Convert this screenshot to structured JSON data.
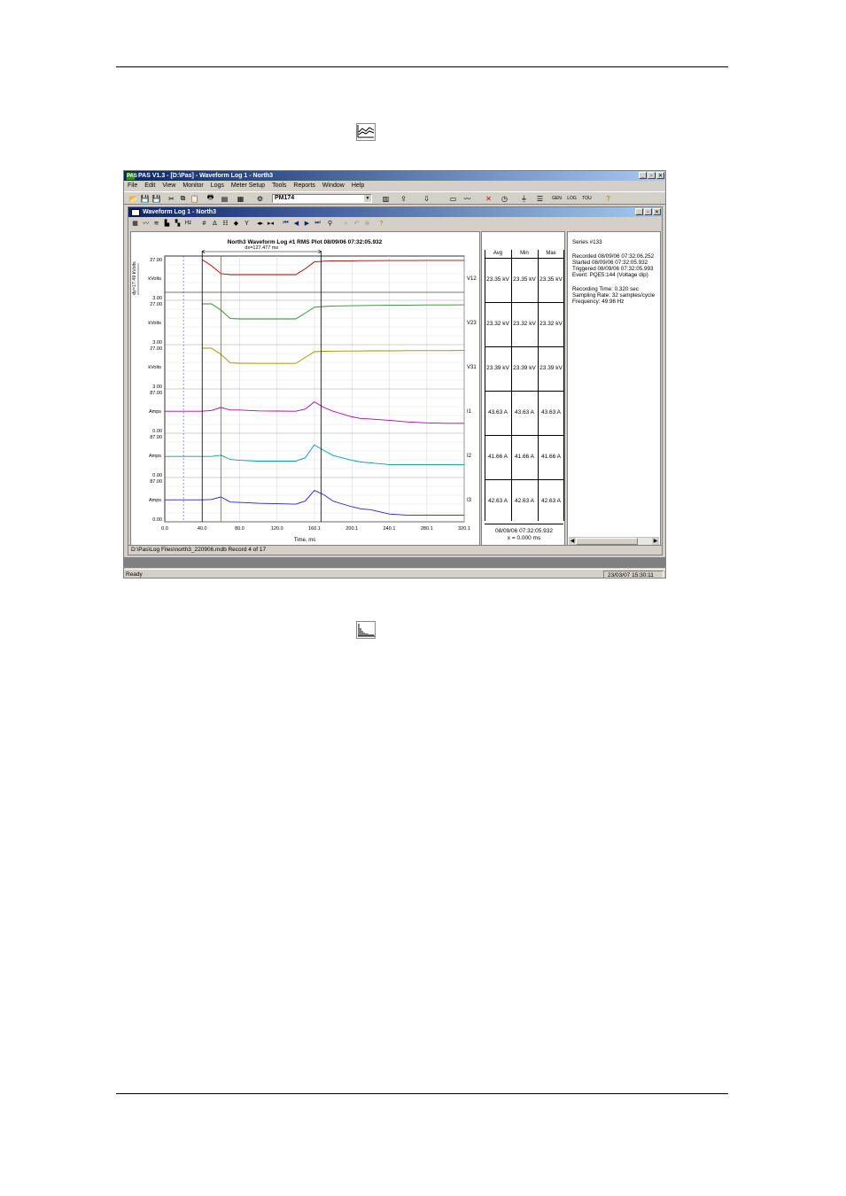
{
  "app": {
    "title": "PAS V1.3 - [D:\\Pas] - Waveform Log 1 - North3",
    "logo_text": "PAS",
    "menu": [
      "File",
      "Edit",
      "View",
      "Monitor",
      "Logs",
      "Meter Setup",
      "Tools",
      "Reports",
      "Window",
      "Help"
    ],
    "site_combo": "PM174",
    "toolbar_labels": {
      "gen": "GEN",
      "log": "LOG",
      "tou": "TOU"
    },
    "status_left": "Ready",
    "status_clock": "23/03/07 15:30:11",
    "colors": {
      "titlebar_start": "#0a246a",
      "titlebar_end": "#a6caf0",
      "face": "#d4d0c8"
    }
  },
  "child": {
    "title": "Waveform Log 1 - North3",
    "status": "D:\\Pas\\Log Files\\north3_220906.mdb   Record 4 of 17"
  },
  "chart_data": {
    "type": "line",
    "title": "North3  Waveform Log #1  RMS Plot  08/09/06  07:32:05.932",
    "xlabel": "Time, ms",
    "xlim": [
      0,
      320.1
    ],
    "x_ticks": [
      "0.0",
      "40.0",
      "80.0",
      "120.0",
      "160.1",
      "200.1",
      "240.1",
      "280.1",
      "320.1"
    ],
    "annotation_dx": "dx=127.477 ms",
    "annotation_dy": "dy=17.49 kVolts",
    "cursor_x_ms": [
      0,
      40,
      60,
      167
    ],
    "x": [
      0,
      20,
      40,
      50,
      60,
      70,
      80,
      100,
      120,
      140,
      150,
      160,
      170,
      180,
      200,
      210,
      220,
      240,
      260,
      280,
      300,
      320
    ],
    "panels": [
      {
        "name": "V12",
        "unit": "kVolts",
        "ymin_label": "3.00",
        "ymax_label": "27.00",
        "ylim": [
          3,
          27
        ],
        "color": "#b00000",
        "values": [
          null,
          null,
          27,
          23,
          18,
          17.3,
          17.3,
          17.3,
          17.3,
          17.3,
          21,
          25.5,
          26,
          26.2,
          26.2,
          26.3,
          26.3,
          26.4,
          26.4,
          26.5,
          26.5,
          26.5
        ]
      },
      {
        "name": "V23",
        "unit": "kVolts",
        "ymin_label": "3.00",
        "ymax_label": "27.00",
        "ylim": [
          3,
          27
        ],
        "color": "#2e8b2e",
        "values": [
          null,
          null,
          27,
          27,
          23,
          17.5,
          17.3,
          17.3,
          17.3,
          17.3,
          21,
          24.8,
          25.3,
          25.6,
          25.8,
          25.9,
          26,
          26.1,
          26.2,
          26.3,
          26.3,
          26.4
        ]
      },
      {
        "name": "V31",
        "unit": "kVolts",
        "ymin_label": "3.00",
        "ymax_label": "27.00",
        "ylim": [
          3,
          27
        ],
        "color": "#a09000",
        "values": [
          null,
          null,
          27,
          27,
          23,
          17.5,
          17.3,
          17.2,
          17.2,
          17.2,
          21,
          24.7,
          25,
          25.1,
          25.2,
          25.2,
          25.3,
          25.3,
          25.4,
          25.4,
          25.4,
          25.5
        ]
      },
      {
        "name": "I1",
        "unit": "Amps",
        "ymin_label": "0.00",
        "ymax_label": "87.00",
        "ylim": [
          0,
          87
        ],
        "color": "#b000b0",
        "values": [
          43,
          43,
          43,
          45,
          52,
          46,
          46,
          44,
          43.5,
          43,
          48,
          65,
          52,
          43,
          30,
          26,
          25,
          22,
          18,
          16,
          15,
          15
        ]
      },
      {
        "name": "I2",
        "unit": "Amps",
        "ymin_label": "0.00",
        "ymax_label": "87.00",
        "ylim": [
          0,
          87
        ],
        "color": "#009fa0",
        "values": [
          41,
          41,
          41,
          41,
          44,
          34,
          32,
          30,
          30,
          30,
          38,
          68,
          55,
          43,
          32,
          28,
          26,
          22,
          22,
          22,
          22,
          22
        ]
      },
      {
        "name": "I3",
        "unit": "Amps",
        "ymin_label": "0.00",
        "ymax_label": "87.00",
        "ylim": [
          0,
          87
        ],
        "color": "#2020d0",
        "values": [
          43,
          43,
          43,
          44,
          50,
          38,
          37,
          35,
          34,
          33,
          40,
          65,
          55,
          40,
          27,
          22,
          20,
          10,
          7,
          7,
          7,
          7
        ]
      }
    ],
    "grid": true
  },
  "readings": {
    "headers": [
      "Avg",
      "Min",
      "Max"
    ],
    "rows": [
      [
        "23.35 kV",
        "23.35 kV",
        "23.35 kV"
      ],
      [
        "23.32 kV",
        "23.32 kV",
        "23.32 kV"
      ],
      [
        "23.39 kV",
        "23.39 kV",
        "23.39 kV"
      ],
      [
        "43.63 A",
        "43.63 A",
        "43.63 A"
      ],
      [
        "41.66 A",
        "41.66 A",
        "41.66 A"
      ],
      [
        "42.63 A",
        "42.63 A",
        "42.63 A"
      ]
    ],
    "footer_time": "08/09/06  07:32:05.932",
    "footer_x": "x = 0.000 ms"
  },
  "info": {
    "lines": [
      "Series #133",
      "",
      "Recorded 08/09/06  07:32:06.252",
      "Started    08/09/06  07:32:05.932",
      "Triggered  08/09/06  07:32:05.993",
      "Event: PQE5:144 (Voltage dip)",
      "",
      "Recording Time: 0.320 sec",
      "Sampling Rate: 32 samples/cycle",
      "Frequency: 49.96 Hz"
    ]
  }
}
